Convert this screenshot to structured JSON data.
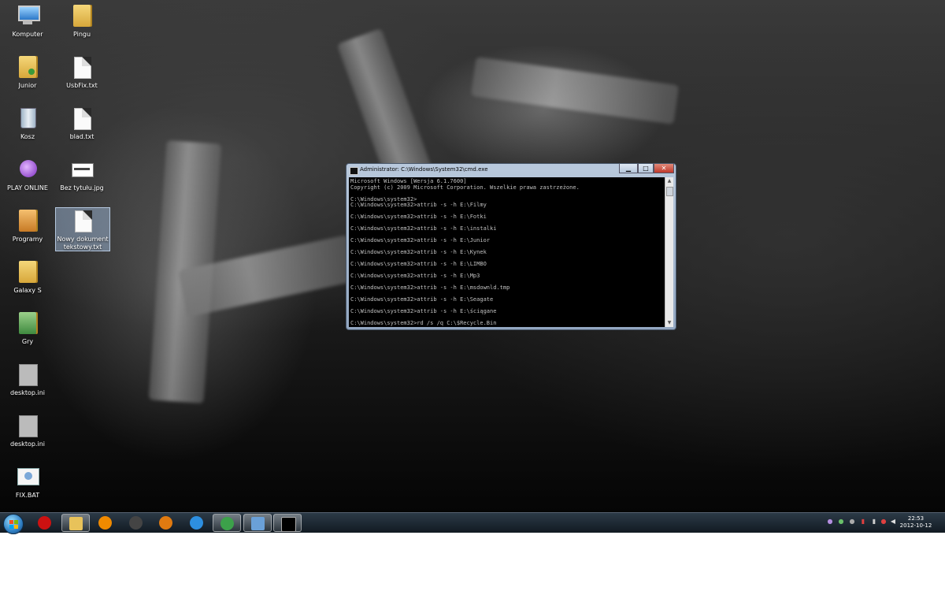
{
  "desktop": {
    "icons": [
      {
        "label": "Komputer",
        "icon": "computer-icon"
      },
      {
        "label": "Pingu",
        "icon": "folder-icon"
      },
      {
        "label": "Junior",
        "icon": "user-folder-icon"
      },
      {
        "label": "UsbFix.txt",
        "icon": "text-file-icon"
      },
      {
        "label": "Kosz",
        "icon": "recycle-bin-icon"
      },
      {
        "label": "blad.txt",
        "icon": "text-file-icon"
      },
      {
        "label": "PLAY ONLINE",
        "icon": "app-icon"
      },
      {
        "label": "Bez tytułu.jpg",
        "icon": "image-file-icon"
      },
      {
        "label": "Programy",
        "icon": "folder-icon"
      },
      {
        "label": "Nowy dokument tekstowy.txt",
        "icon": "text-file-icon"
      },
      {
        "label": "Galaxy S",
        "icon": "folder-icon"
      },
      {
        "label": "Gry",
        "icon": "folder-icon"
      },
      {
        "label": "desktop.ini",
        "icon": "settings-file-icon"
      },
      {
        "label": "desktop.ini",
        "icon": "settings-file-icon"
      },
      {
        "label": "FIX.BAT",
        "icon": "batch-file-icon"
      }
    ]
  },
  "cmd": {
    "title": "Administrator: C:\\Windows\\System32\\cmd.exe",
    "lines": [
      "Microsoft Windows [Wersja 6.1.7600]",
      "Copyright (c) 2009 Microsoft Corporation. Wszelkie prawa zastrzeżone.",
      "",
      "C:\\Windows\\system32>",
      "C:\\Windows\\system32>attrib -s -h E:\\Filmy",
      "",
      "C:\\Windows\\system32>attrib -s -h E:\\Fotki",
      "",
      "C:\\Windows\\system32>attrib -s -h E:\\instalki",
      "",
      "C:\\Windows\\system32>attrib -s -h E:\\Junior",
      "",
      "C:\\Windows\\system32>attrib -s -h E:\\Kynek",
      "",
      "C:\\Windows\\system32>attrib -s -h E:\\LIMBO",
      "",
      "C:\\Windows\\system32>attrib -s -h E:\\Mp3",
      "",
      "C:\\Windows\\system32>attrib -s -h E:\\msdownld.tmp",
      "",
      "C:\\Windows\\system32>attrib -s -h E:\\Seagate",
      "",
      "C:\\Windows\\system32>attrib -s -h E:\\ściągane",
      "",
      "C:\\Windows\\system32>rd /s /q C:\\$Recycle.Bin"
    ],
    "minimize_glyph": "▁",
    "maximize_glyph": "□",
    "close_glyph": "✕"
  },
  "taskbar": {
    "items": [
      {
        "icon": "opera-icon",
        "color": "#cc1111"
      },
      {
        "icon": "explorer-icon",
        "color": "#e8c25a"
      },
      {
        "icon": "vlc-icon",
        "color": "#f08a00"
      },
      {
        "icon": "media-player-icon",
        "color": "#444444"
      },
      {
        "icon": "media-center-icon",
        "color": "#e07a10"
      },
      {
        "icon": "internet-explorer-icon",
        "color": "#2d8fe0"
      },
      {
        "icon": "chrome-icon",
        "color": "#3ca14a"
      },
      {
        "icon": "image-viewer-icon",
        "color": "#6aa0d8"
      },
      {
        "icon": "cmd-icon",
        "color": "#000000"
      }
    ],
    "clock_time": "22:53",
    "clock_date": "2012-10-12"
  },
  "colors": {
    "cmd_text": "#c0c0c0",
    "selection": "#aac8eb"
  }
}
